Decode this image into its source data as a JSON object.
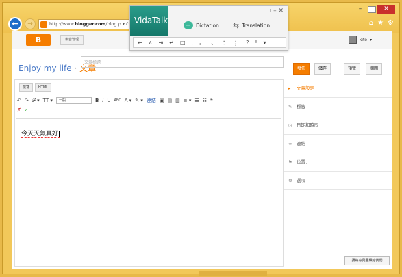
{
  "browser": {
    "url_prefix": "http://www.",
    "url_domain": "blogger.com",
    "url_suffix": "/blog",
    "url_tools": "ρ ▾ ć",
    "controls": {
      "minimize": "–",
      "maximize": "",
      "close": "✕"
    },
    "toolbar_icons": [
      "⌂",
      "★",
      "⚙"
    ]
  },
  "blogger": {
    "logo": "B",
    "dashboard_label": "後台管理",
    "user_name": "kite",
    "user_caret": "▾"
  },
  "post": {
    "blog_name": "Enjoy my life",
    "separator": " · ",
    "section": "文章",
    "title_placeholder": "文章標題",
    "buttons": {
      "publish": "發佈",
      "save": "儲存",
      "preview": "預覽",
      "close": "關閉"
    }
  },
  "editor": {
    "tabs": [
      "撰寫",
      "HTML"
    ],
    "toolbar": [
      "↶",
      "↷",
      "𝓕 ▾",
      "ΤT ▾"
    ],
    "format_select": "一般",
    "format_buttons": [
      "B",
      "I",
      "U",
      "ABC",
      "A ▾",
      "✎ ▾",
      "連結",
      "▣",
      "▤",
      "▥",
      "≡ ▾",
      "☰",
      "☷",
      "❝"
    ],
    "row2": [
      "T̸",
      "✓"
    ],
    "content": "今天天氣真好"
  },
  "sidebar": {
    "items": [
      {
        "icon": "▸",
        "label": "文章設定"
      },
      {
        "icon": "✎",
        "label": "標籤"
      },
      {
        "icon": "◷",
        "label": "日期和時間"
      },
      {
        "icon": "∞",
        "label": "連結"
      },
      {
        "icon": "⚑",
        "label": "位置："
      },
      {
        "icon": "⚙",
        "label": "選項"
      }
    ],
    "feedback": "請將意見回饋給我們"
  },
  "vidatalk": {
    "logo": "VidaTalk",
    "close": "i – ✕",
    "dictation": "Dictation",
    "translation": "Translation",
    "keys": [
      "←",
      "∧",
      "⇥",
      "↵",
      "□",
      ",",
      "。",
      "、",
      "：",
      "；",
      "?",
      "!",
      "▾"
    ]
  },
  "colors": {
    "accent": "#f57d00",
    "frame": "#f2c85a",
    "link": "#4d7cc8",
    "vida": "#2a9c8a"
  }
}
